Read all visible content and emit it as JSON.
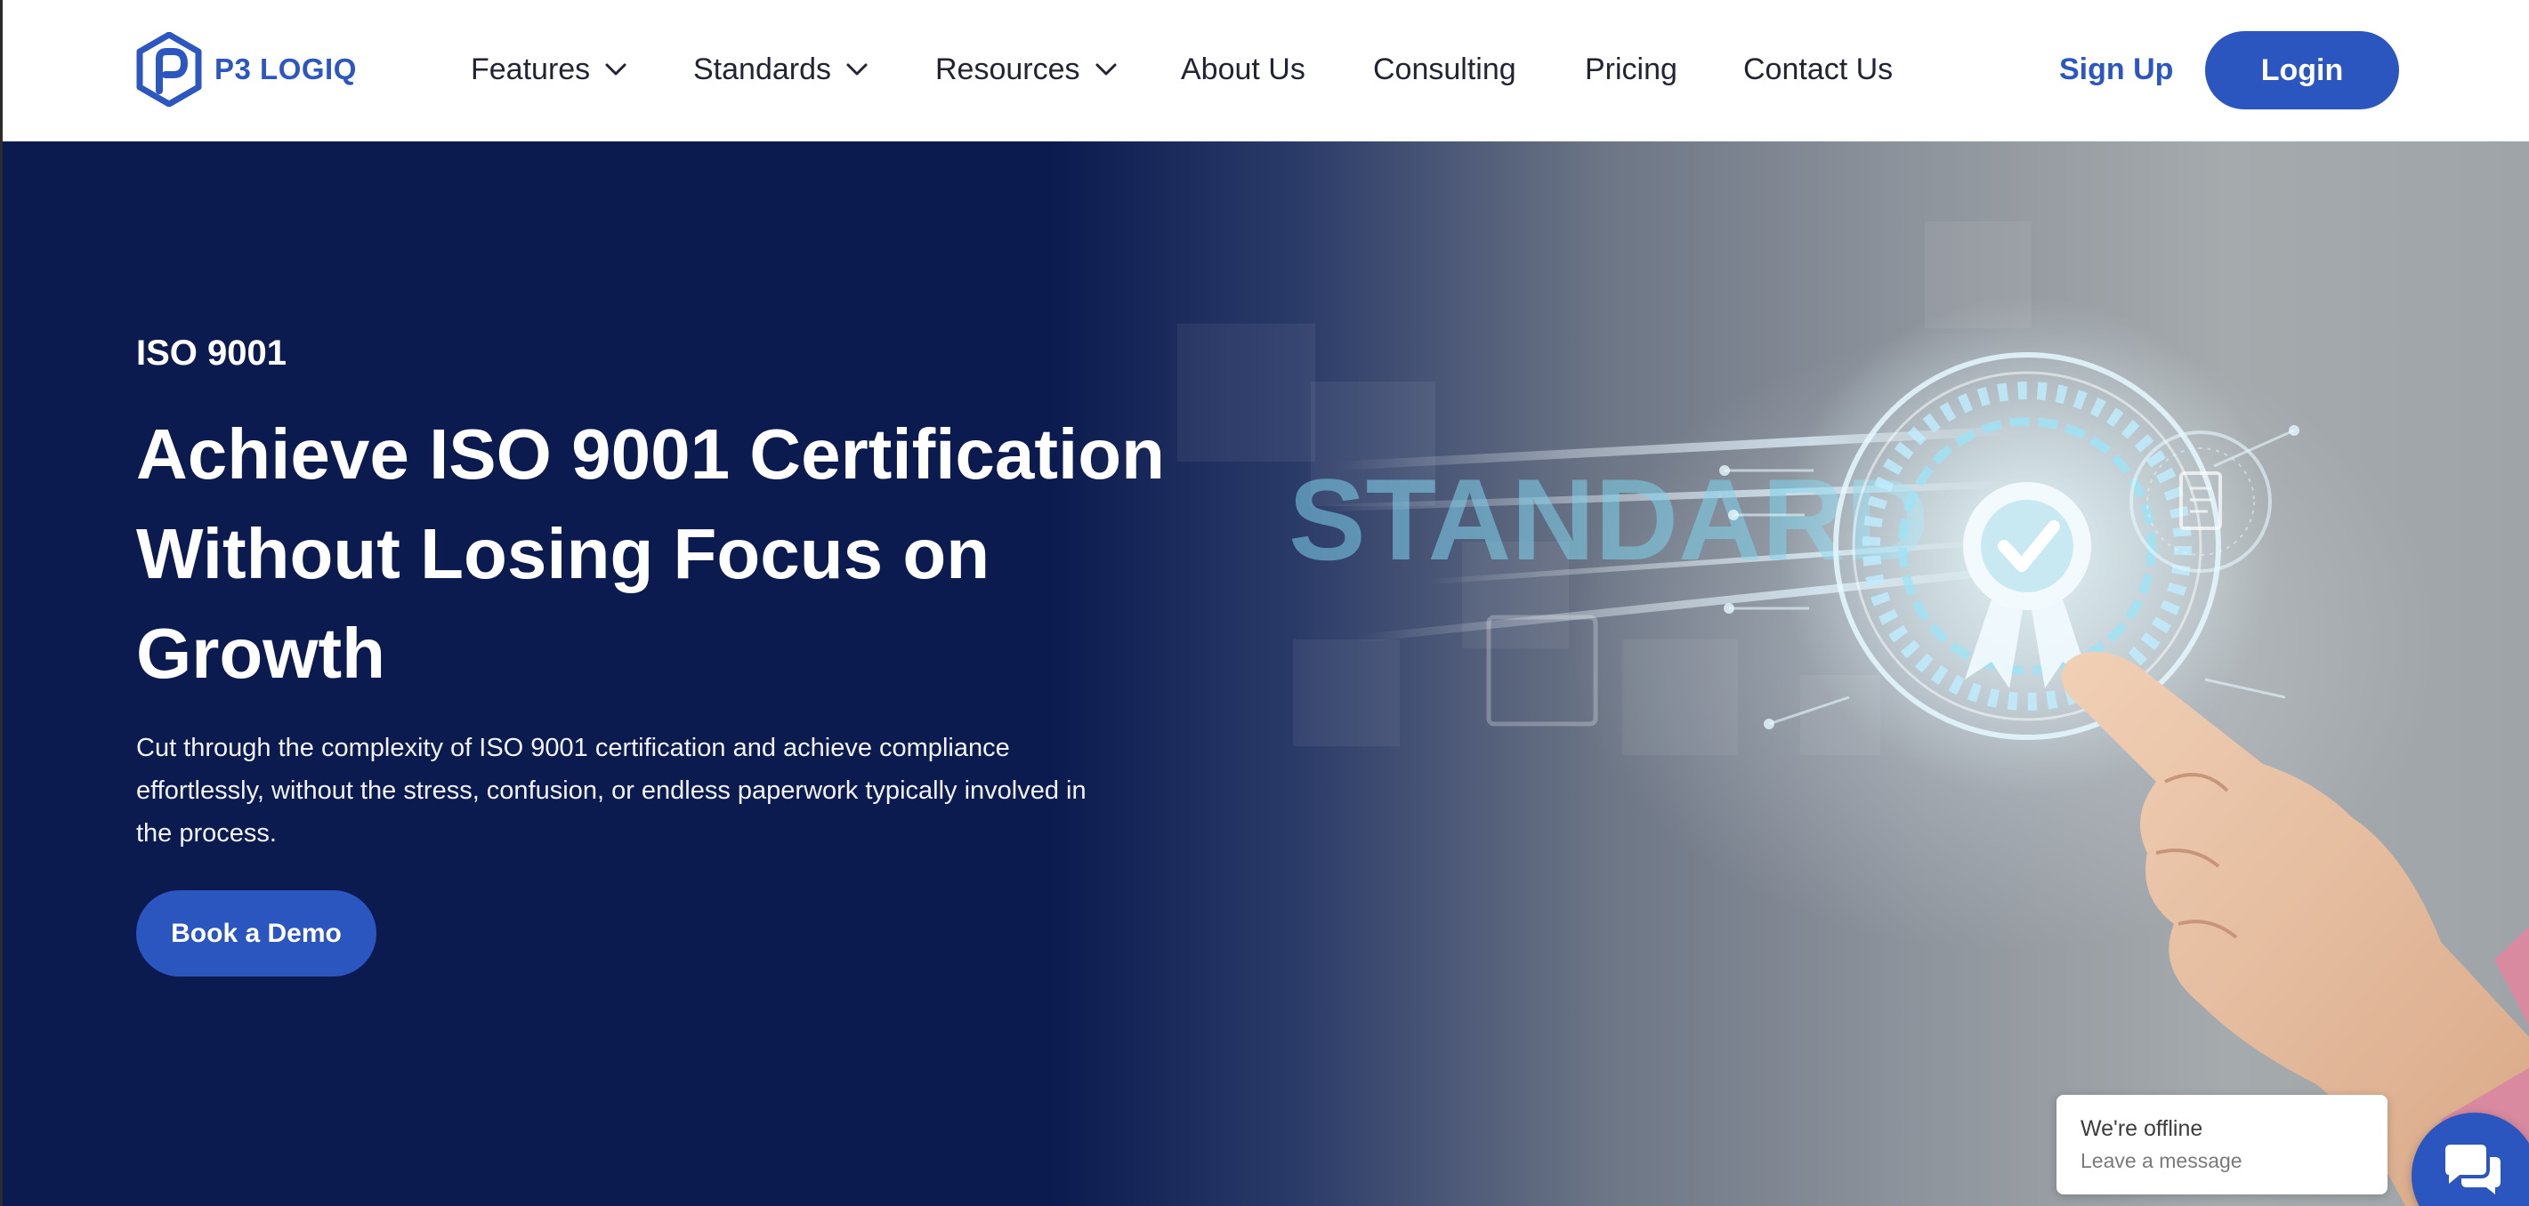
{
  "brand": {
    "name": "P3 LOGIQ",
    "accent": "#2b55bf",
    "hero_background": "#0c1b4f"
  },
  "nav": {
    "items": [
      {
        "label": "Features",
        "has_dropdown": true
      },
      {
        "label": "Standards",
        "has_dropdown": true
      },
      {
        "label": "Resources",
        "has_dropdown": true
      },
      {
        "label": "About Us",
        "has_dropdown": false
      },
      {
        "label": "Consulting",
        "has_dropdown": false
      },
      {
        "label": "Pricing",
        "has_dropdown": false
      },
      {
        "label": "Contact Us",
        "has_dropdown": false
      }
    ],
    "sign_up": "Sign Up",
    "login": "Login"
  },
  "hero": {
    "eyebrow": "ISO 9001",
    "title_lines": [
      "Achieve ISO 9001 Certification",
      "Without Losing Focus on",
      "Growth"
    ],
    "description_lines": [
      "Cut through the complexity of ISO 9001 certification and achieve compliance",
      "effortlessly, without the stress, confusion, or endless paperwork typically involved in",
      "the process."
    ],
    "cta": "Book a Demo",
    "image_text": "STANDARD"
  },
  "chat": {
    "status": "We're offline",
    "subtitle": "Leave a message"
  },
  "icons": {
    "logo": "hexagon-p-logo-icon",
    "dropdown": "chevron-down-icon",
    "chat": "chat-bubbles-icon"
  }
}
